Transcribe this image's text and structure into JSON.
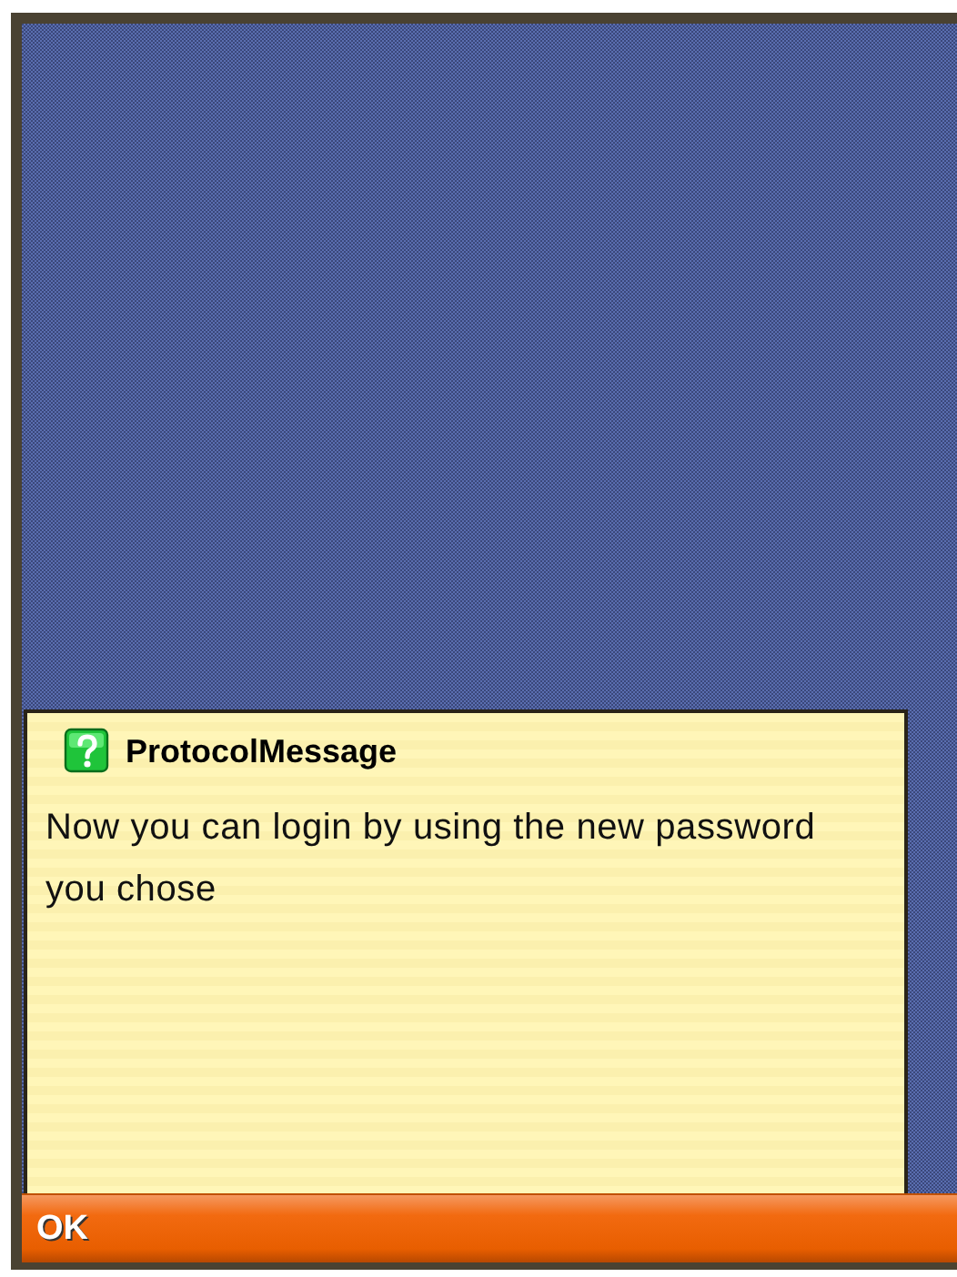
{
  "dialog": {
    "title": "ProtocolMessage",
    "message": "Now you can login by using the new password you chose"
  },
  "softkeys": [
    {
      "label": "OK"
    }
  ]
}
